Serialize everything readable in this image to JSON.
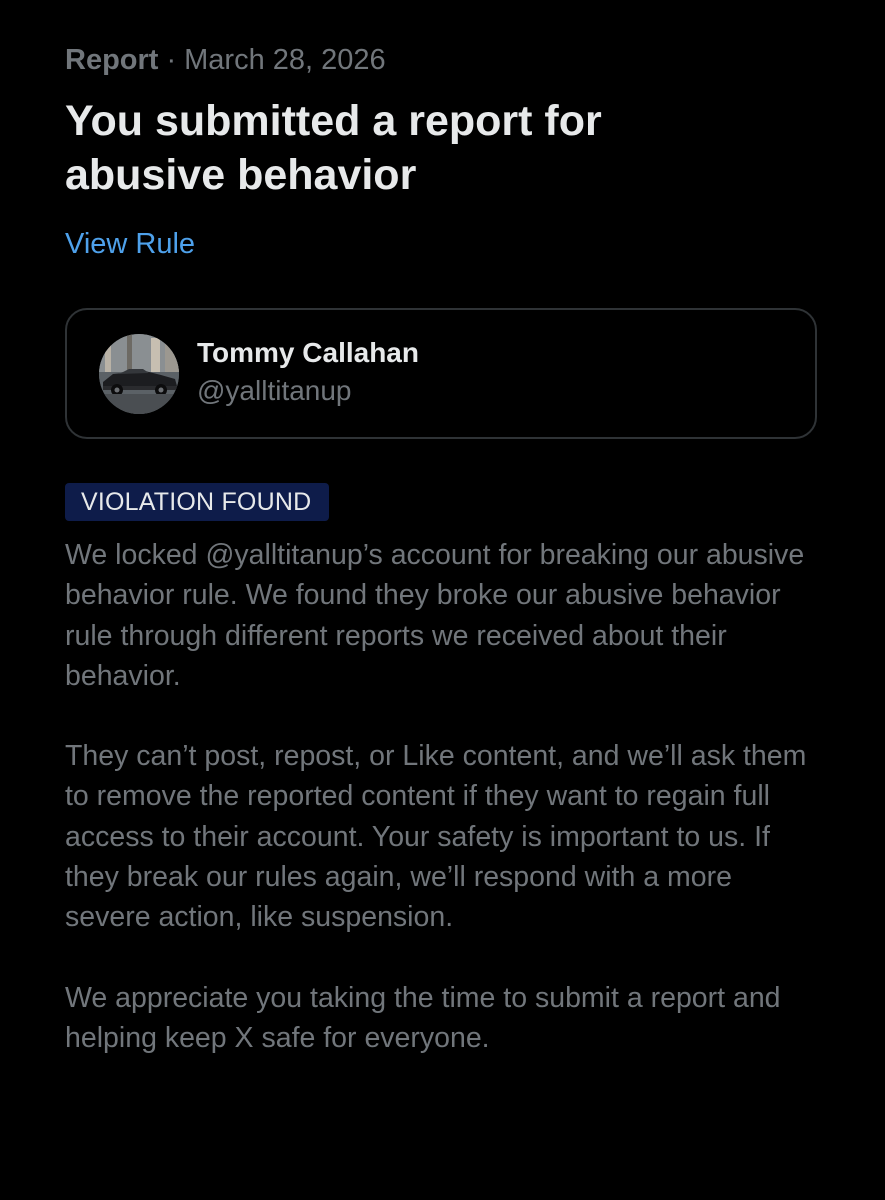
{
  "header": {
    "type_label": "Report",
    "separator": "·",
    "date": "March 28, 2026"
  },
  "title": "You submitted a report for abusive behavior",
  "view_rule_label": "View Rule",
  "reported_user": {
    "name": "Tommy Callahan",
    "handle": "@yalltitanup",
    "avatar_icon": "profile-photo-car"
  },
  "status_badge": "VIOLATION FOUND",
  "paragraphs": [
    "We locked @yalltitanup’s account for breaking our abusive behavior rule. We found they broke our abusive behavior rule through different reports we received about their behavior.",
    "They can’t post, repost, or Like content, and we’ll ask them to remove the reported content if they want to regain full access to their account. Your safety is important to us. If they break our rules again, we’ll respond with a more severe action, like suspension.",
    "We appreciate you taking the time to submit a report and helping keep X safe for everyone."
  ],
  "colors": {
    "background": "#000000",
    "primary_text": "#e7e9ea",
    "secondary_text": "#71767b",
    "link": "#4ea1eb",
    "badge_background": "#0e1c4a",
    "card_border": "#2f3336"
  }
}
